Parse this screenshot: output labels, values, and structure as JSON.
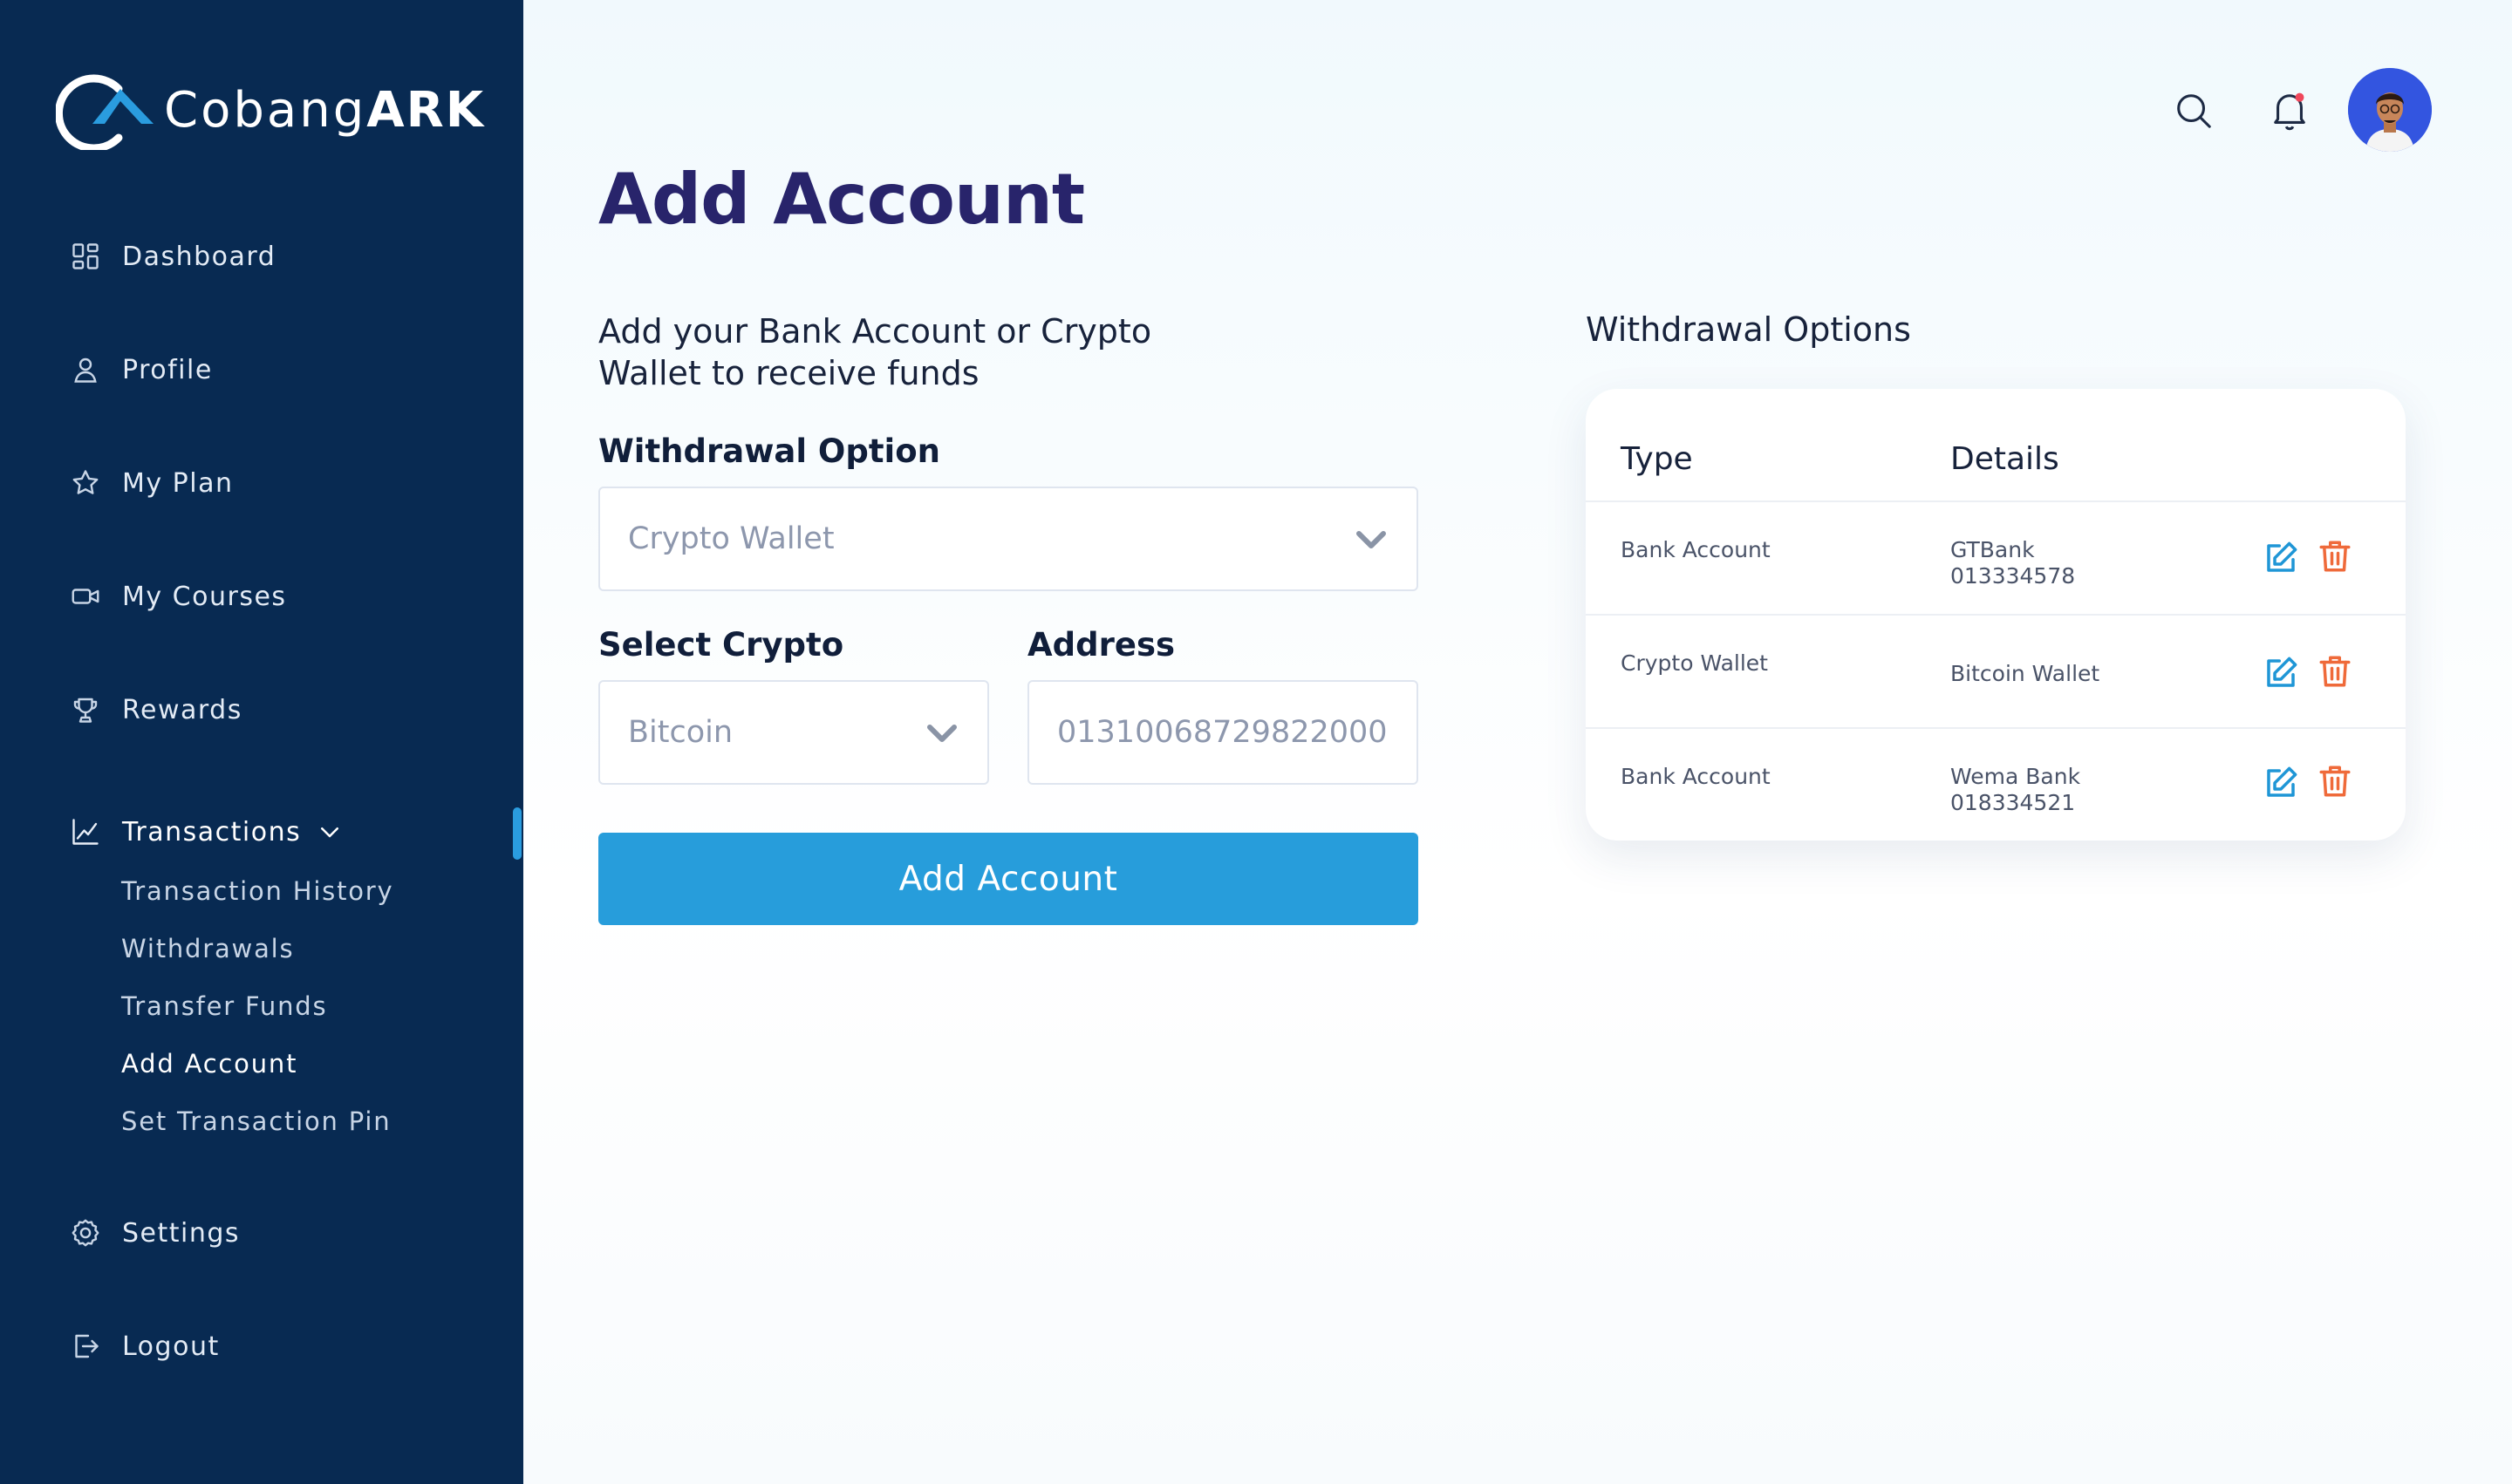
{
  "brand": {
    "name_light": "Cobang",
    "name_bold": "ARK"
  },
  "nav": {
    "dashboard": "Dashboard",
    "profile": "Profile",
    "my_plan": "My Plan",
    "my_courses": "My Courses",
    "rewards": "Rewards",
    "transactions": "Transactions",
    "transaction_sub": {
      "history": "Transaction History",
      "withdrawals": "Withdrawals",
      "transfer": "Transfer Funds",
      "add_account": "Add Account",
      "set_pin": "Set Transaction Pin"
    },
    "settings": "Settings",
    "logout": "Logout"
  },
  "page": {
    "title": "Add Account",
    "intro": "Add your Bank Account or Crypto Wallet to receive funds"
  },
  "form": {
    "withdrawal_option_label": "Withdrawal Option",
    "withdrawal_option_value": "Crypto Wallet",
    "select_crypto_label": "Select Crypto",
    "select_crypto_value": "Bitcoin",
    "address_label": "Address",
    "address_value": "01310068729822000",
    "submit_label": "Add Account"
  },
  "withdrawal_options": {
    "title": "Withdrawal Options",
    "columns": {
      "type": "Type",
      "details": "Details"
    },
    "rows": [
      {
        "type": "Bank Account",
        "details_line1": "GTBank",
        "details_line2": "013334578"
      },
      {
        "type": "Crypto Wallet",
        "details_line1": "Bitcoin Wallet",
        "details_line2": ""
      },
      {
        "type": "Bank Account",
        "details_line1": "Wema Bank",
        "details_line2": "018334521"
      }
    ]
  },
  "colors": {
    "sidebar_bg": "#082a52",
    "accent": "#279ddb",
    "title": "#28246b",
    "delete": "#ef6a3a",
    "notification_dot": "#f0475b"
  },
  "icons": {
    "dashboard": "grid-icon",
    "profile": "user-icon",
    "my_plan": "star-icon",
    "my_courses": "video-icon",
    "rewards": "trophy-icon",
    "transactions": "chart-line-icon",
    "settings": "gear-icon",
    "logout": "logout-icon",
    "search": "search-icon",
    "notifications": "bell-icon",
    "edit": "edit-icon",
    "delete": "trash-icon"
  }
}
